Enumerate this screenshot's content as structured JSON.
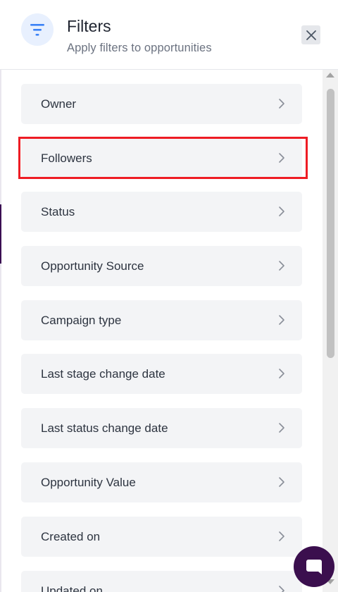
{
  "header": {
    "title": "Filters",
    "subtitle": "Apply filters to opportunities",
    "icon": "filter-icon",
    "close_icon": "close-icon"
  },
  "filters": [
    {
      "label": "Owner"
    },
    {
      "label": "Followers"
    },
    {
      "label": "Status"
    },
    {
      "label": "Opportunity Source"
    },
    {
      "label": "Campaign type"
    },
    {
      "label": "Last stage change date"
    },
    {
      "label": "Last status change date"
    },
    {
      "label": "Opportunity Value"
    },
    {
      "label": "Created on"
    },
    {
      "label": "Updated on"
    }
  ],
  "highlighted_item": "Followers",
  "colors": {
    "accent": "#3b82f6",
    "highlight": "#ee1c24",
    "chat_button": "#3b0f4e",
    "item_background": "#f3f4f6"
  },
  "chat": {
    "icon": "chat-icon"
  }
}
